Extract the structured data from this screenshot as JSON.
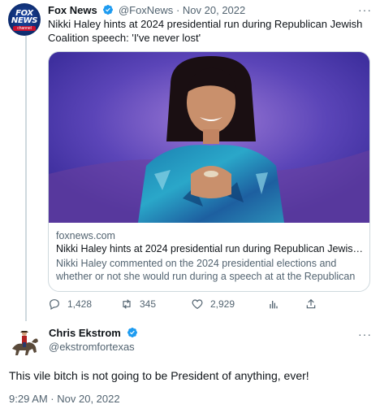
{
  "tweet": {
    "author_name": "Fox News",
    "author_handle": "@FoxNews",
    "separator": "·",
    "date": "Nov 20, 2022",
    "text": "Nikki Haley hints at 2024 presidential run during Republican Jewish Coalition speech: 'I've never lost'",
    "avatar_text_line1": "FOX",
    "avatar_text_line2": "NEWS",
    "avatar_text_line3": "channel",
    "card": {
      "domain": "foxnews.com",
      "title": "Nikki Haley hints at 2024 presidential run during Republican Jewish ...",
      "description": "Nikki Haley commented on the 2024 presidential elections and whether or not she would run during a speech at at the Republican ..."
    },
    "actions": {
      "replies": "1,428",
      "retweets": "345",
      "likes": "2,929"
    }
  },
  "reply": {
    "author_name": "Chris Ekstrom",
    "author_handle": "@ekstromfortexas",
    "text": "This vile bitch is not going to be President of anything, ever!",
    "timestamp": "9:29 AM · Nov 20, 2022"
  },
  "colors": {
    "verified": "#1d9bf0",
    "secondary_text": "#536471",
    "border": "#cfd9de",
    "fox_red": "#c8102e",
    "fox_blue": "#0c2a6b"
  },
  "icons": [
    "fox-news-logo-icon",
    "verified-badge-icon",
    "more-icon",
    "reply-icon",
    "retweet-icon",
    "like-icon",
    "analytics-icon",
    "share-icon"
  ]
}
